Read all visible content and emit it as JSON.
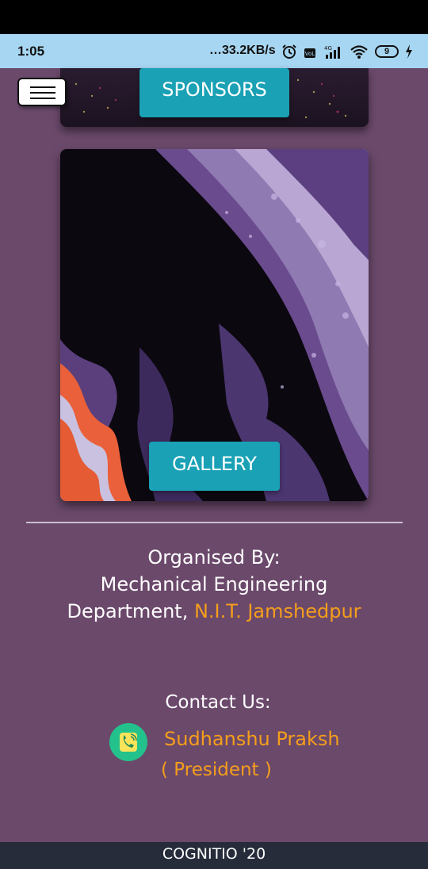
{
  "status_bar": {
    "time": "1:05",
    "network_speed": "…33.2KB/s",
    "battery_level": "9",
    "icons": [
      "alarm-icon",
      "volte-icon",
      "signal-icon",
      "wifi-icon",
      "battery-icon",
      "charging-icon"
    ]
  },
  "menu": {
    "icon": "hamburger-icon"
  },
  "cards": {
    "sponsors_label": "SPONSORS",
    "gallery_label": "GALLERY"
  },
  "organiser": {
    "heading": "Organised By:",
    "line1": "Mechanical Engineering",
    "line2_prefix": "Department, ",
    "line2_highlight": "N.I.T. Jamshedpur"
  },
  "contact": {
    "heading": "Contact Us:",
    "name": "Sudhanshu Praksh",
    "role": "( President )",
    "icon": "phone-icon"
  },
  "footer": {
    "text": "COGNITIO '20"
  },
  "colors": {
    "background": "#6b496b",
    "accent_button": "#1aa1b5",
    "highlight_text": "#f59e1b",
    "phone_icon_bg": "#23c28c",
    "footer_bg": "#262c3a",
    "status_bar_bg": "#a7d6f2"
  }
}
